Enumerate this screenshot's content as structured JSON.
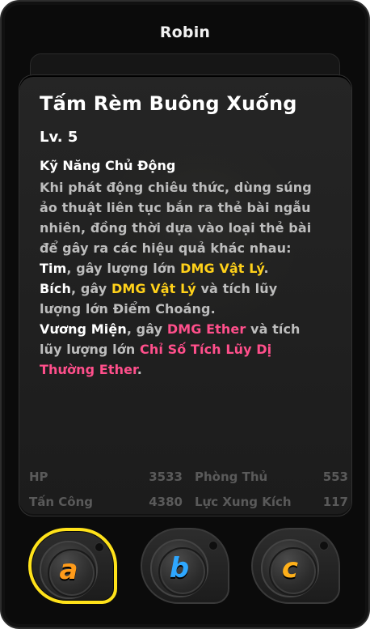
{
  "header": {
    "title": "Robin"
  },
  "card": {
    "skill_name": "Tấm Rèm Buông Xuống",
    "level": "Lv. 5",
    "section_title": "Kỹ Năng Chủ Động",
    "description": {
      "line1": "Khi phát động chiêu thức, dùng súng",
      "line2": "ảo thuật liên tục bắn ra thẻ bài ngẫu",
      "line3": "nhiên, đồng thời dựa vào loại thẻ bài",
      "line4": "để gây ra các hiệu quả khác nhau:",
      "line5_prefix": "Tim",
      "line5_mid": ", gây lượng lớn ",
      "line5_highlight": "DMG Vật Lý",
      "line5_suffix": ".",
      "line6_prefix": "Bích",
      "line6_mid": ", gây ",
      "line6_highlight": "DMG Vật Lý",
      "line6_suffix": " và tích lũy",
      "line7": "lượng lớn Điểm Choáng.",
      "line8_prefix": "Vương Miện",
      "line8_mid": ", gây ",
      "line8_highlight": "DMG Ether",
      "line8_suffix": " và tích",
      "line9_prefix": "lũy lượng lớn ",
      "line9_highlight": "Chỉ Số Tích Lũy Dị",
      "line10_highlight": "Thường Ether",
      "line10_suffix": "."
    },
    "stats": {
      "hp_label": "HP",
      "hp_value": "3533",
      "def_label": "Phòng Thủ",
      "def_value": "553",
      "atk_label": "Tấn Công",
      "atk_value": "4380",
      "impact_label": "Lực Xung Kích",
      "impact_value": "117"
    }
  },
  "skills": [
    {
      "key": "a",
      "label": "a",
      "selected": true
    },
    {
      "key": "b",
      "label": "b",
      "selected": false
    },
    {
      "key": "c",
      "label": "c",
      "selected": false
    }
  ],
  "colors": {
    "accent_yellow": "#ffe21a",
    "text_yellow": "#ffd11a",
    "text_pink": "#ff4f8b",
    "skill_a": "#ff9b1a",
    "skill_b": "#2ea7ff",
    "skill_c": "#ffb01a"
  }
}
